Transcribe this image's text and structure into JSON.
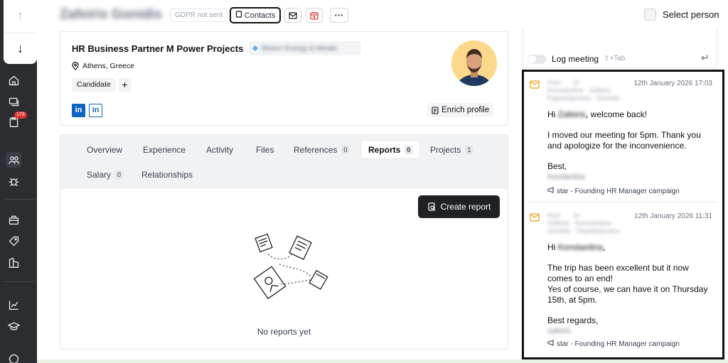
{
  "nav": {
    "up_icon": "arrow-up-icon",
    "down_icon": "arrow-down-icon",
    "badge": "173",
    "items": [
      "home-icon",
      "messages-icon",
      "clipboard-icon",
      "people-icon",
      "bug-icon",
      "briefcase-icon",
      "tag-icon",
      "building-icon",
      "chart-icon",
      "graduation-icon",
      "help-icon"
    ]
  },
  "header": {
    "person_name": "Zafeiris Gonidis",
    "gdpr": "GDPR not sent",
    "contacts_label": "Contacts",
    "select_person": "Select person"
  },
  "profile": {
    "title": "HR Business Partner M Power Projects",
    "company": "Motion Energy & Metals",
    "location": "Athens, Greece",
    "tag": "Candidate",
    "add": "+",
    "linkedin": "in",
    "enrich_label": "Enrich profile"
  },
  "tabs": [
    {
      "label": "Overview",
      "count": ""
    },
    {
      "label": "Experience",
      "count": ""
    },
    {
      "label": "Activity",
      "count": ""
    },
    {
      "label": "Files",
      "count": ""
    },
    {
      "label": "References",
      "count": "0"
    },
    {
      "label": "Reports",
      "count": "0"
    },
    {
      "label": "Projects",
      "count": "1"
    },
    {
      "label": "Salary",
      "count": "0"
    },
    {
      "label": "Relationships",
      "count": ""
    }
  ],
  "reports": {
    "create_label": "Create report",
    "empty_text": "No reports yet"
  },
  "log_meeting": {
    "label": "Log meeting",
    "shortcut": "⇧+Tab",
    "enter": "↵"
  },
  "messages": [
    {
      "from_label": "from",
      "from_name_1": "Konstantina",
      "from_name_2": "Papadopoulou",
      "to_label": "to",
      "to_name_1": "Zafeiris",
      "to_name_2": "Gonidis",
      "date": "12th January 2026 17:03",
      "greeting_prefix": "Hi ",
      "greeting_name": "Zafeiris",
      "greeting_suffix": ", welcome back!",
      "line1": "I moved our meeting for 5pm. Thank you",
      "line2": "and apologize for the inconvenience.",
      "signoff": "Best,",
      "signature": "Konstantina",
      "campaign": "star - Founding HR Manager campaign"
    },
    {
      "from_label": "from",
      "from_name_1": "Zafeiris",
      "from_name_2": "Gonidis",
      "to_label": "to",
      "to_name_1": "Konstantina",
      "to_name_2": "Papadopoulou",
      "date": "12th January 2026 11:31",
      "greeting_prefix": "Hi ",
      "greeting_name": "Konstantina",
      "greeting_suffix": ",",
      "line1": "The trip has been excellent but it now",
      "line2": "comes to an end!",
      "line3": "Yes of course, we can have it on Thursday",
      "line4": "15th, at 5pm.",
      "signoff": "Best regards,",
      "signature": "Zafeiris",
      "campaign": "star - Founding HR Manager campaign"
    }
  ],
  "colors": {
    "rail": "#2b2d31",
    "accent_dark": "#1f2124",
    "linkedin": "#0a66c2",
    "mail_icon": "#f59e0b",
    "badge": "#e03131"
  }
}
